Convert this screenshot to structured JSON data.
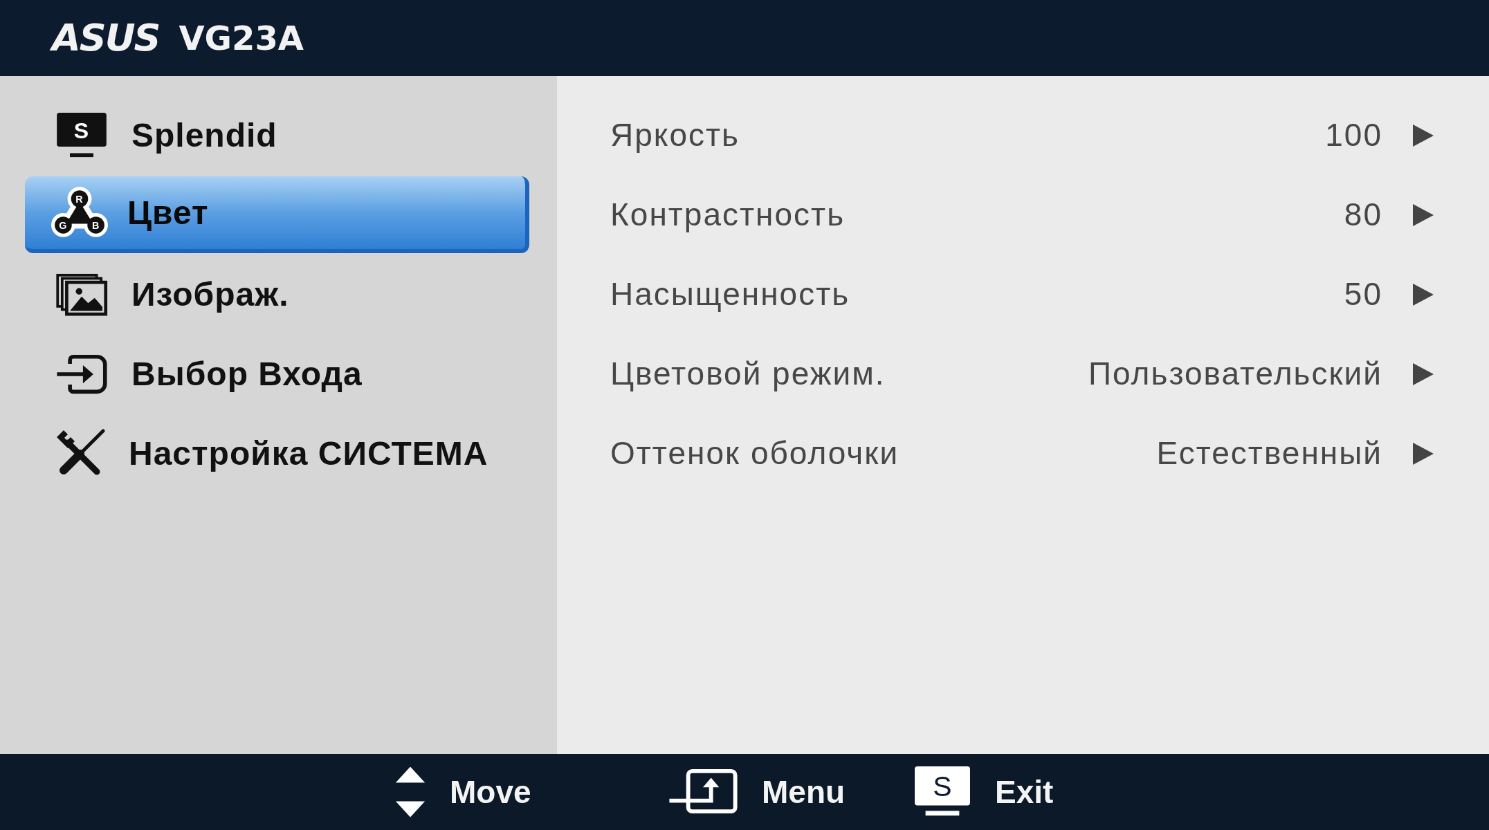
{
  "header": {
    "logo": "ASUS",
    "model": "VG23A"
  },
  "sidebar": {
    "items": [
      {
        "label": "Splendid",
        "selected": false,
        "icon_letters": [
          "S"
        ]
      },
      {
        "label": "Цвет",
        "selected": true,
        "icon_letters": [
          "R",
          "G",
          "B"
        ]
      },
      {
        "label": "Изображ.",
        "selected": false
      },
      {
        "label": "Выбор Входа",
        "selected": false
      },
      {
        "label": "Настройка СИСТЕМА",
        "selected": false
      }
    ]
  },
  "settings": {
    "rows": [
      {
        "label": "Яркость",
        "value": "100"
      },
      {
        "label": "Контрастность",
        "value": "80"
      },
      {
        "label": "Насыщенность",
        "value": "50"
      },
      {
        "label": "Цветовой режим.",
        "value": "Пользовательский"
      },
      {
        "label": "Оттенок оболочки",
        "value": "Естественный"
      }
    ]
  },
  "footer": {
    "hints": [
      {
        "label": "Move"
      },
      {
        "label": "Menu"
      },
      {
        "label": "Exit",
        "icon_letters": [
          "S"
        ]
      }
    ]
  }
}
